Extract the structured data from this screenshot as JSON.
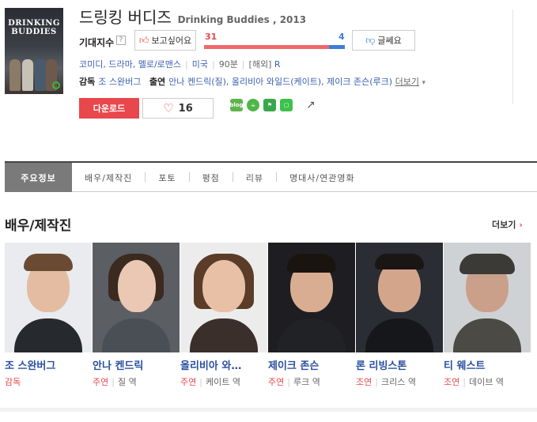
{
  "movie": {
    "poster_title": "DRINKING BUDDIES",
    "title_ko": "드링킹 버디즈",
    "title_en": "Drinking Buddies , 2013"
  },
  "expect": {
    "label": "기대지수",
    "help": "?",
    "want_label": "보고싶어요",
    "want_count": "31",
    "notwant_count": "4",
    "want_ratio": 0.886,
    "notwant_label": "글쎄요"
  },
  "info": {
    "genres": "코미디, 드라마, 멜로/로맨스",
    "country": "미국",
    "runtime": "90분",
    "rating_prefix": "[해외]",
    "rating": "R"
  },
  "credits": {
    "director_label": "감독",
    "director": "조 스완버그",
    "cast_label": "출연",
    "cast": "안나 켄드릭(질), 올리비아 와일드(케이트), 제이크 존슨(루크)",
    "more": "더보기"
  },
  "actions": {
    "download": "다운로드",
    "like_count": "16",
    "share_icons": [
      "blog-icon",
      "cafe-icon",
      "bookmark-icon",
      "line-icon"
    ]
  },
  "colors": {
    "accent_red": "#e8474c",
    "accent_blue": "#3d7fd6",
    "link": "#2a4fa0"
  },
  "tabs": [
    {
      "label": "주요정보",
      "active": true
    },
    {
      "label": "배우/제작진"
    },
    {
      "label": "포토"
    },
    {
      "label": "평점"
    },
    {
      "label": "리뷰"
    },
    {
      "label": "명대사/연관영화"
    }
  ],
  "section": {
    "title": "배우/제작진",
    "more": "더보기"
  },
  "people": [
    {
      "name": "조 스완버그",
      "type": "감독",
      "role": ""
    },
    {
      "name": "안나 켄드릭",
      "type": "주연",
      "role": "질 역"
    },
    {
      "name": "올리비아 와…",
      "type": "주연",
      "role": "케이트 역"
    },
    {
      "name": "제이크 존슨",
      "type": "주연",
      "role": "루크 역"
    },
    {
      "name": "론 리빙스톤",
      "type": "조연",
      "role": "크리스 역"
    },
    {
      "name": "티 웨스트",
      "type": "조연",
      "role": "데이브 역"
    }
  ]
}
